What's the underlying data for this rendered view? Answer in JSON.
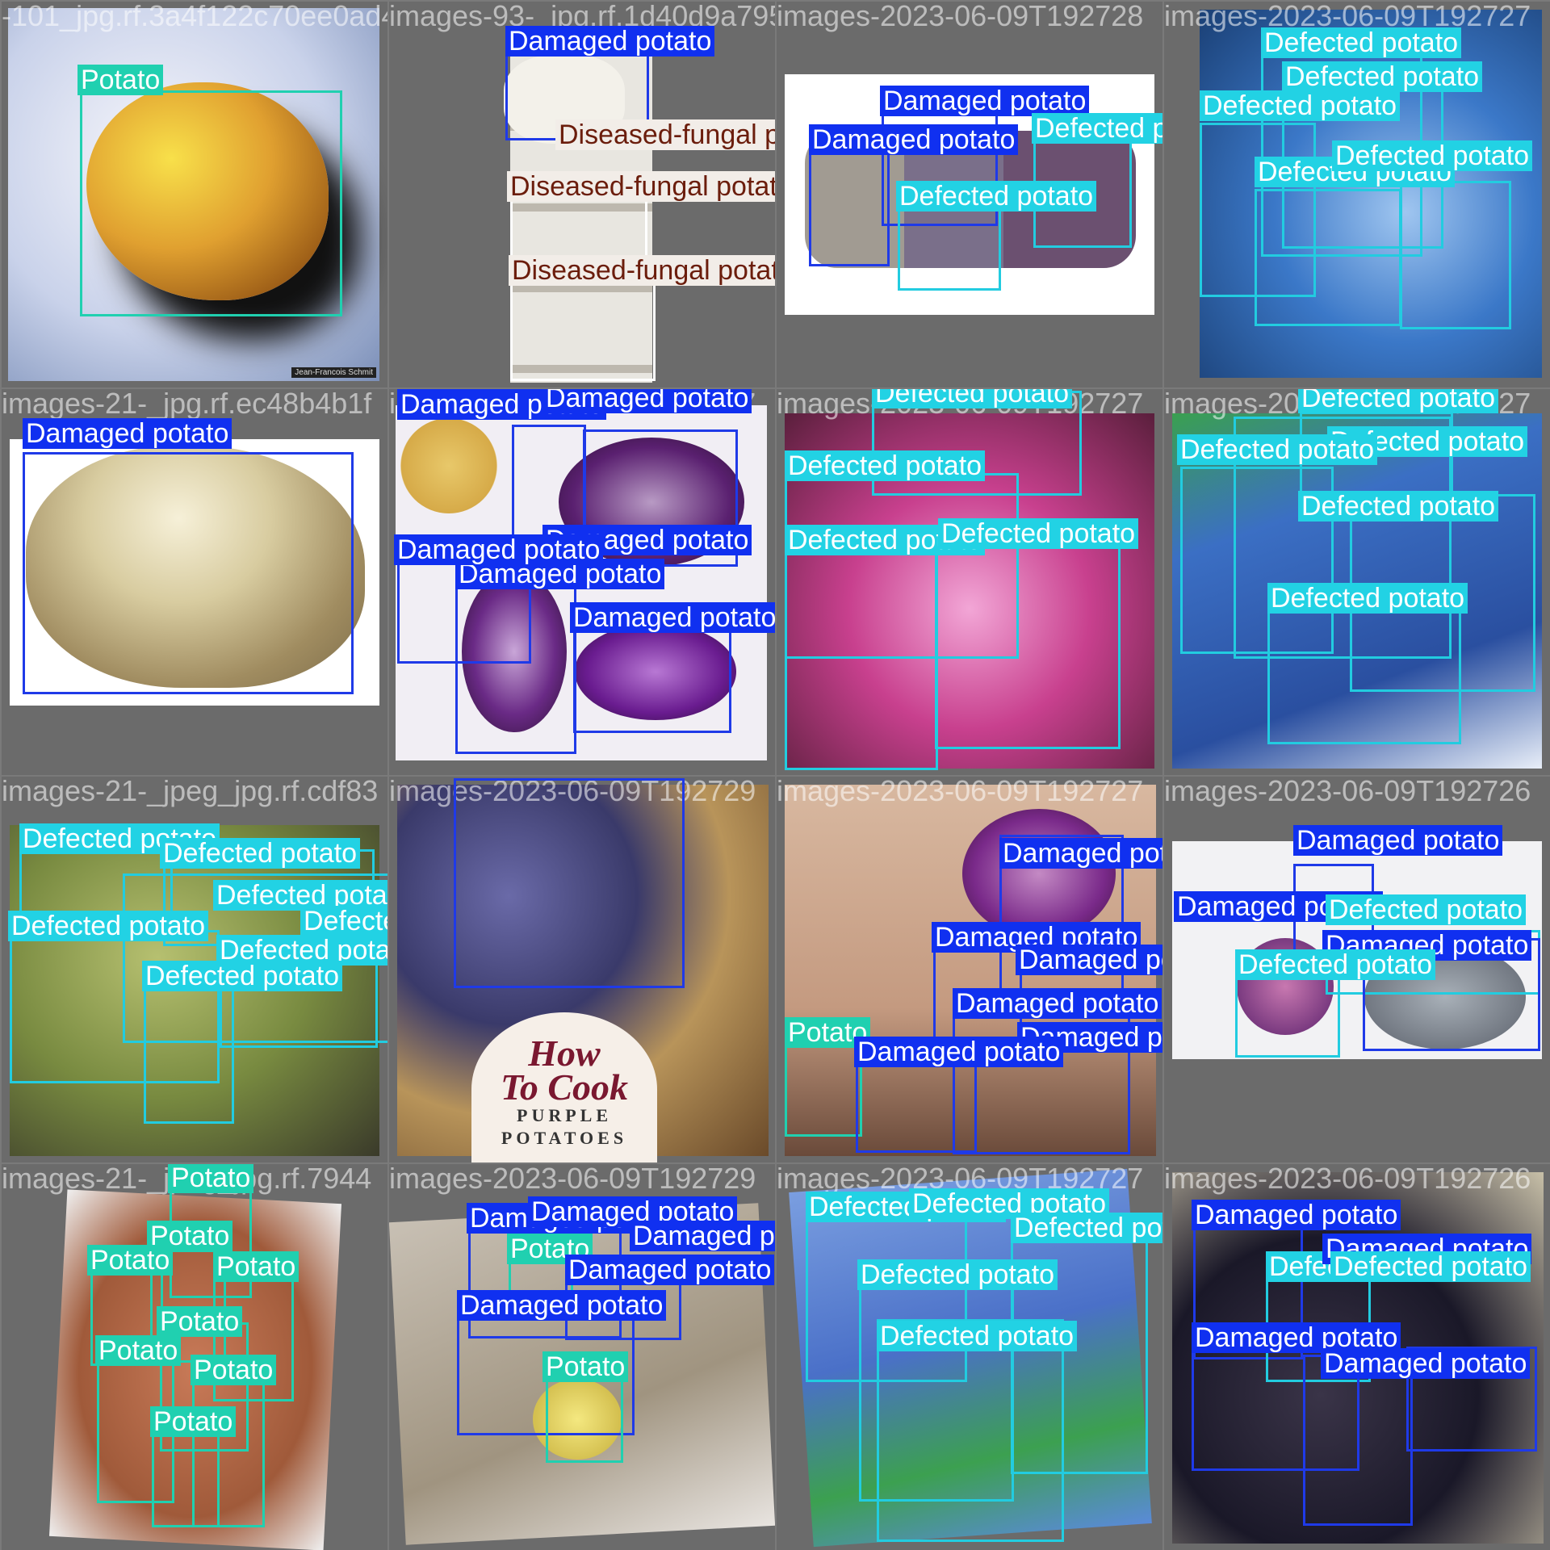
{
  "labels": {
    "potato": "Potato",
    "damaged": "Damaged potato",
    "defected": "Defected potato",
    "fungal": "Diseased-fungal potato"
  },
  "colors": {
    "potato": "#20d0b0",
    "damaged": "#1030f0",
    "defected": "#22d2e4",
    "fungal_text": "#6b1d0c"
  },
  "tiles": [
    {
      "filename": "-101_jpg.rf.3a4f122c70ee0ad445e9",
      "credit": "Jean-Francois Schmit"
    },
    {
      "filename": "images-93-_jpg.rf.1d40d9a7958023676"
    },
    {
      "filename": "images-2023-06-09T192728"
    },
    {
      "filename": "images-2023-06-09T192727"
    },
    {
      "filename": "images-21-_jpg.rf.ec48b4b1f"
    },
    {
      "filename": "images-2023-06-09T192727"
    },
    {
      "filename": "images-2023-06-09T192727"
    },
    {
      "filename": "images-2023-06-09T192727"
    },
    {
      "filename": "images-21-_jpeg_jpg.rf.cdf83"
    },
    {
      "filename": "images-2023-06-09T192729",
      "poster": {
        "line1": "How",
        "line2": "To Cook",
        "line3": "PURPLE",
        "line4": "POTATOES"
      }
    },
    {
      "filename": "images-2023-06-09T192727"
    },
    {
      "filename": "images-2023-06-09T192726"
    },
    {
      "filename": "images-21-_jpeg_jpg.rf.7944"
    },
    {
      "filename": "images-2023-06-09T192729"
    },
    {
      "filename": "images-2023-06-09T192727"
    },
    {
      "filename": "images-2023-06-09T192726"
    }
  ]
}
